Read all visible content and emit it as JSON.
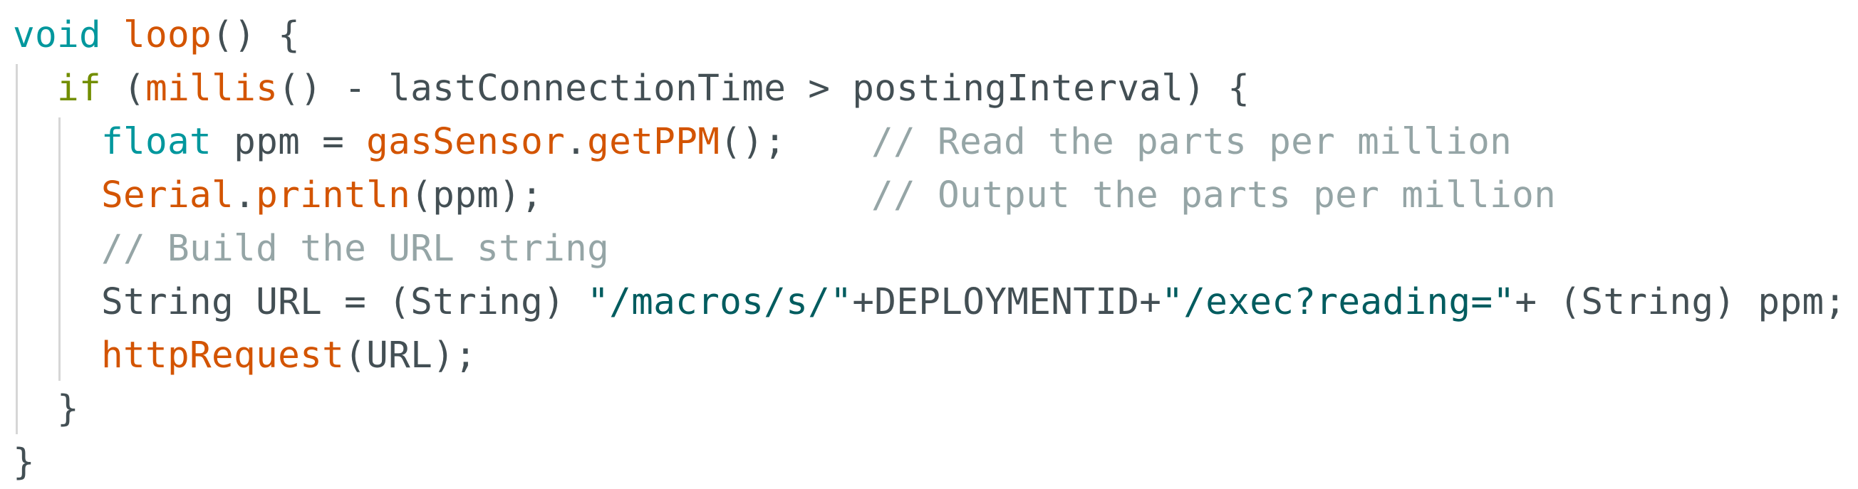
{
  "code": {
    "line1": {
      "type": "void",
      "sp": " ",
      "func": "loop",
      "rest": "() {"
    },
    "line2": {
      "indent": "  ",
      "keyword": "if",
      "sp": " ",
      "open": "(",
      "func": "millis",
      "rest": "() - lastConnectionTime > postingInterval) {"
    },
    "line3": {
      "indent": "    ",
      "type": "float",
      "mid": " ppm = ",
      "obj": "gasSensor",
      "dot": ".",
      "method": "getPPM",
      "rest": "();",
      "comment": "// Read the parts per million"
    },
    "line4": {
      "indent": "    ",
      "obj": "Serial",
      "dot": ".",
      "method": "println",
      "rest": "(ppm);",
      "comment": "// Output the parts per million"
    },
    "line5": {
      "indent": "    ",
      "comment": "// Build the URL string"
    },
    "line6": {
      "indent": "    ",
      "pre": "String URL = (String) ",
      "str1": "\"/macros/s/\"",
      "mid": "+DEPLOYMENTID+",
      "str2": "\"/exec?reading=\"",
      "rest": "+ (String) ppm;"
    },
    "line7": {
      "indent": "    ",
      "func": "httpRequest",
      "rest": "(URL);"
    },
    "line8": {
      "indent": "  ",
      "brace": "}"
    },
    "line9": {
      "brace": "}"
    }
  }
}
